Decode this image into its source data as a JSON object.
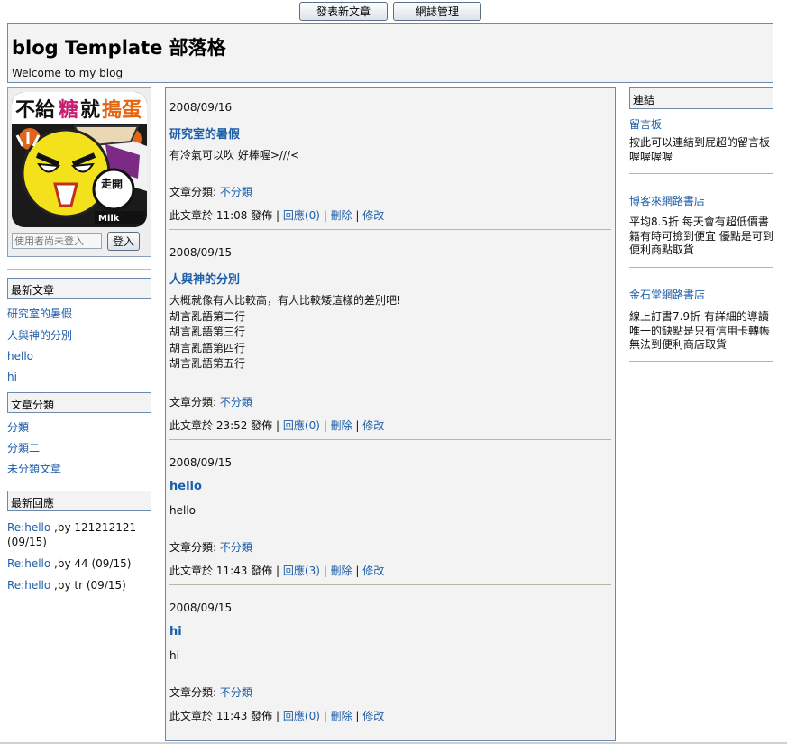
{
  "topbar": {
    "new_post": "發表新文章",
    "manage": "網誌管理"
  },
  "header": {
    "title": "blog Template 部落格",
    "subtitle": "Welcome to my blog"
  },
  "login": {
    "placeholder": "使用者尚未登入",
    "button": "登入"
  },
  "avatar": {
    "text_top_1": "不給",
    "text_top_2": "糖",
    "text_top_3": "就",
    "text_top_4": "搗蛋",
    "badge": "走開"
  },
  "sidebar": {
    "recent_posts_head": "最新文章",
    "recent_posts": [
      "研究室的暑假",
      "人與神的分別",
      "hello",
      "hi"
    ],
    "categories_head": "文章分類",
    "categories": [
      "分類一",
      "分類二",
      "未分類文章"
    ],
    "recent_replies_head": "最新回應",
    "recent_replies": [
      {
        "link": "Re:hello",
        "by": " ,by 121212121 (09/15)"
      },
      {
        "link": "Re:hello",
        "by": " ,by 44 (09/15)"
      },
      {
        "link": "Re:hello",
        "by": " ,by tr (09/15)"
      }
    ]
  },
  "posts": [
    {
      "date": "2008/09/16",
      "title": "研究室的暑假",
      "body": [
        "有冷氣可以吹 好棒喔>///<"
      ],
      "category_label": "文章分類: ",
      "category": "不分類",
      "posted_prefix": "此文章於 11:08 發佈 | ",
      "replies": "回應(0)",
      "delete": "刪除",
      "edit": "修改"
    },
    {
      "date": "2008/09/15",
      "title": "人與神的分別",
      "body": [
        "大概就像有人比較高，有人比較矮這樣的差別吧!",
        "胡言亂語第二行",
        "胡言亂語第三行",
        "胡言亂語第四行",
        "胡言亂語第五行"
      ],
      "category_label": "文章分類: ",
      "category": "不分類",
      "posted_prefix": "此文章於 23:52 發佈 | ",
      "replies": "回應(0)",
      "delete": "刪除",
      "edit": "修改"
    },
    {
      "date": "2008/09/15",
      "title": "hello",
      "body": [
        "hello"
      ],
      "category_label": "文章分類: ",
      "category": "不分類",
      "posted_prefix": "此文章於 11:43 發佈 | ",
      "replies": "回應(3)",
      "delete": "刪除",
      "edit": "修改"
    },
    {
      "date": "2008/09/15",
      "title": "hi",
      "body": [
        "hi"
      ],
      "category_label": "文章分類: ",
      "category": "不分類",
      "posted_prefix": "此文章於 11:43 發佈 | ",
      "replies": "回應(0)",
      "delete": "刪除",
      "edit": "修改"
    }
  ],
  "links": {
    "head": "連結",
    "items": [
      {
        "name": "留言板",
        "desc": "按此可以連結到屁超的留言板喔喔喔喔"
      },
      {
        "name": "博客來網路書店",
        "desc": "平均8.5折 每天會有超低價書籍有時可撿到便宜 優點是可到便利商點取貨"
      },
      {
        "name": "金石堂網路書店",
        "desc": "線上訂書7.9折 有詳細的導讀 唯一的缺點是只有信用卡轉帳 無法到便利商店取貨"
      }
    ]
  },
  "sep": " | ",
  "colors": {
    "link": "#1d5ea8",
    "border": "#6d88a9",
    "panel": "#f3f3f3"
  }
}
